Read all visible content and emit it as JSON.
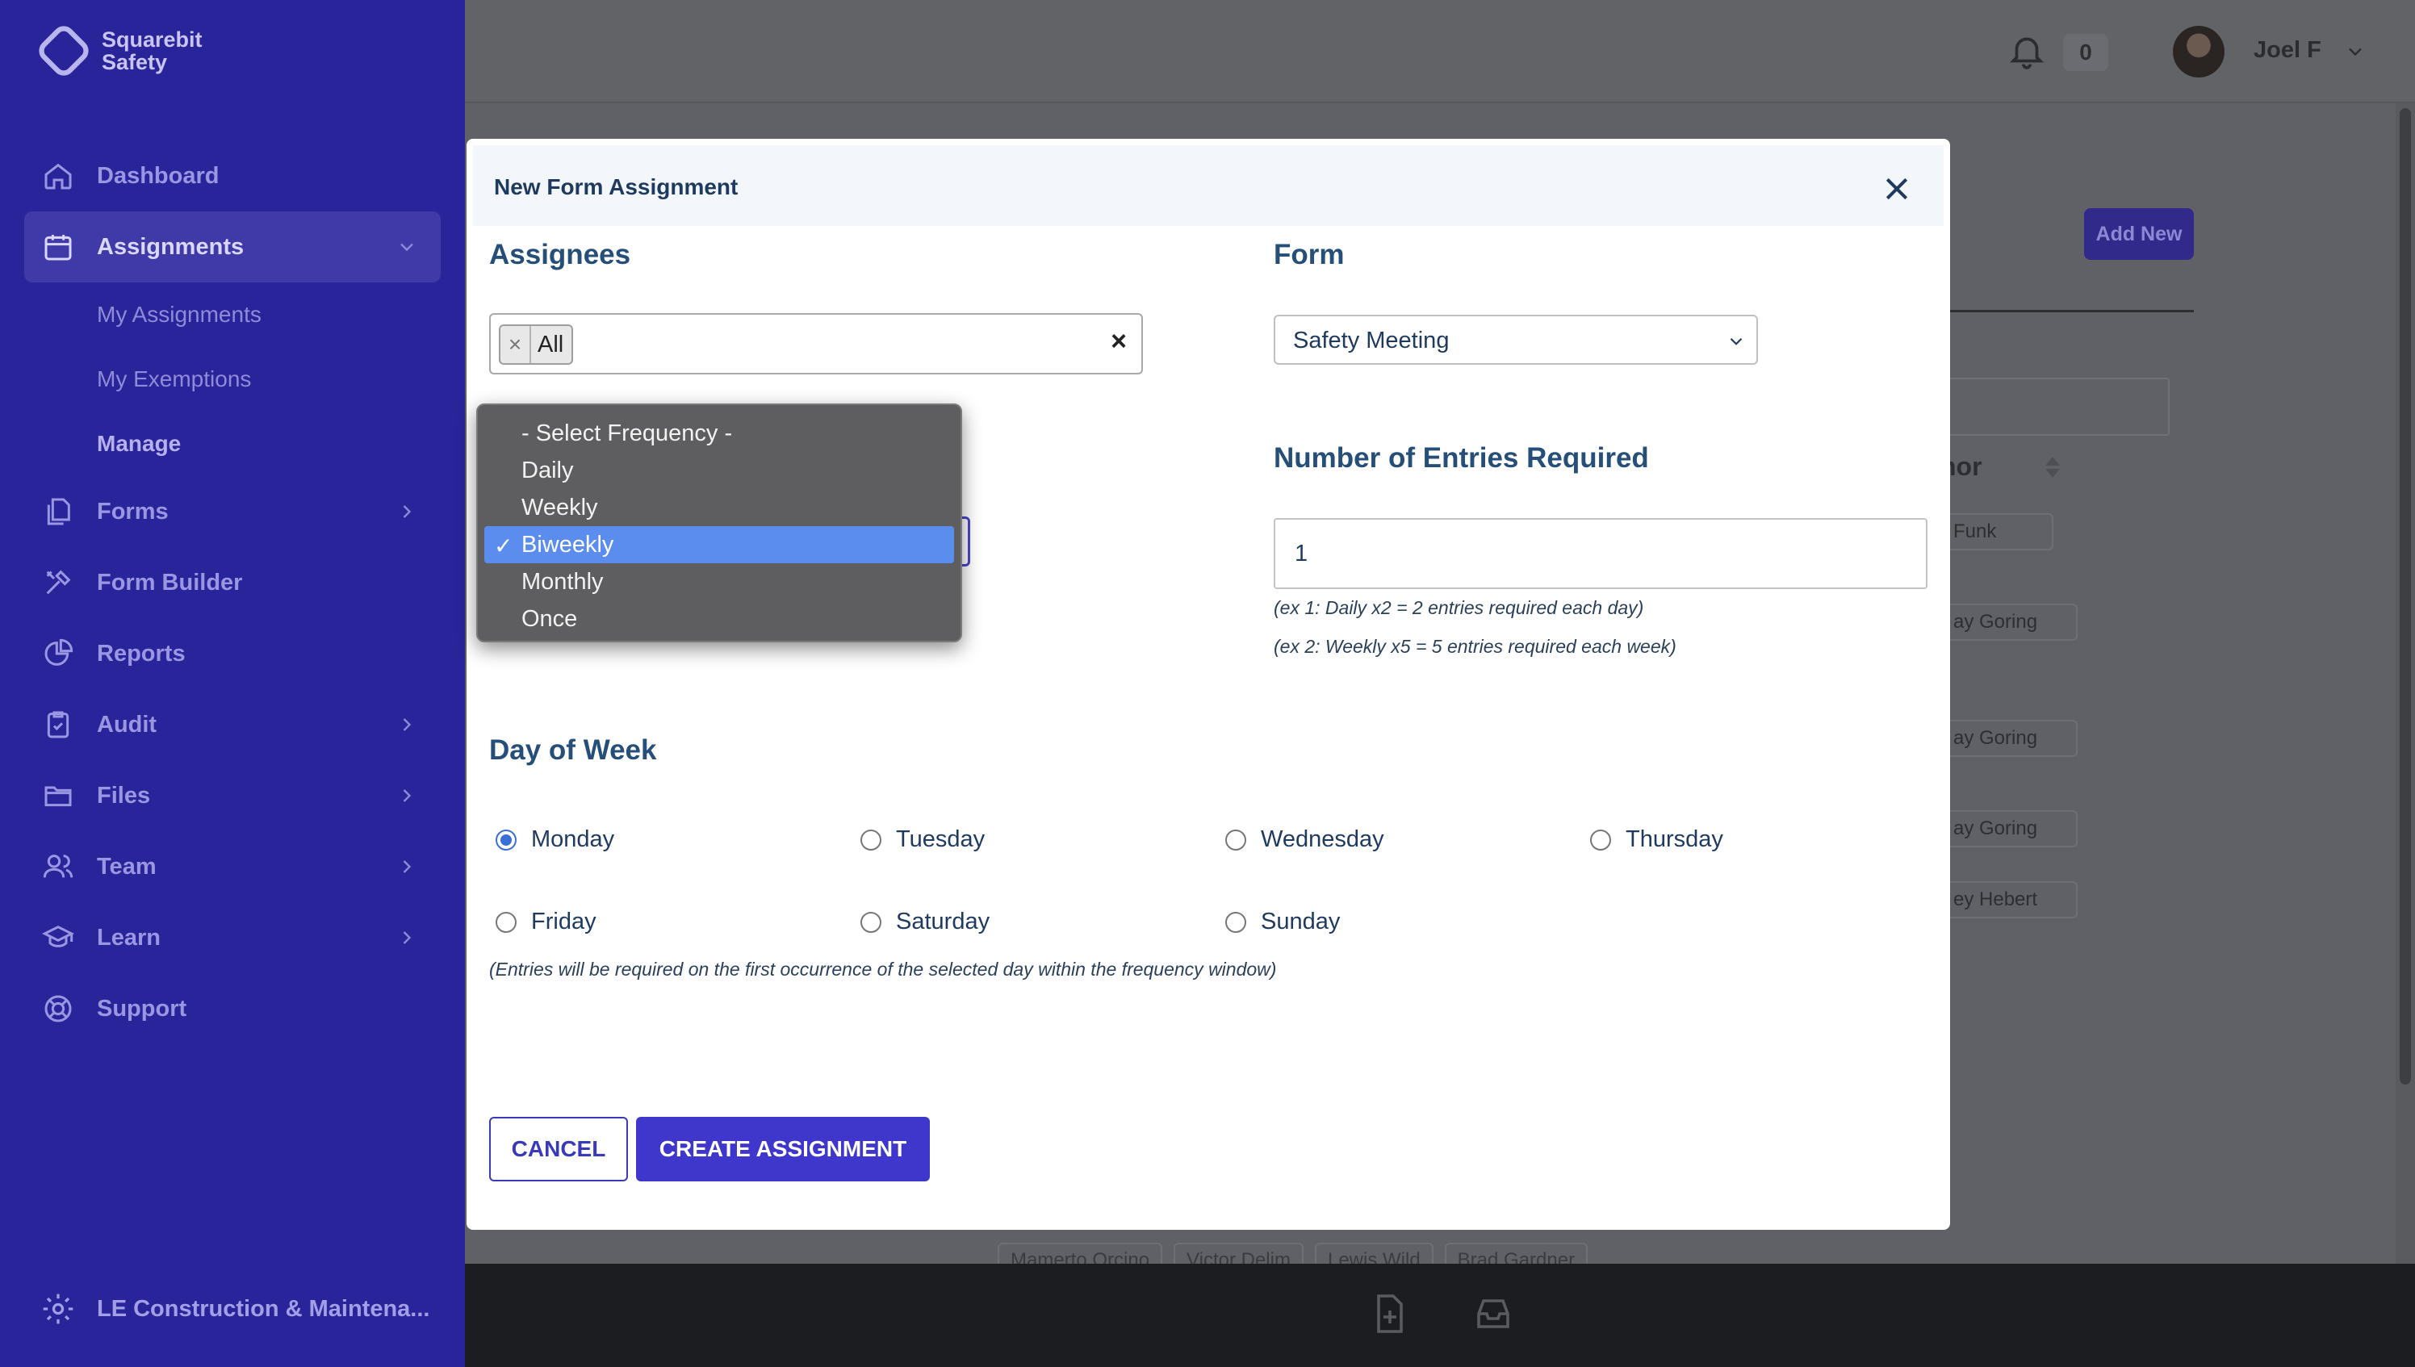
{
  "sidebar": {
    "brand_line1": "Squarebit",
    "brand_line2": "Safety",
    "items": [
      {
        "label": "Dashboard",
        "icon": "home-icon"
      },
      {
        "label": "Assignments",
        "icon": "calendar-icon"
      },
      {
        "label": "Forms",
        "icon": "documents-icon"
      },
      {
        "label": "Form Builder",
        "icon": "tools-icon"
      },
      {
        "label": "Reports",
        "icon": "pie-chart-icon"
      },
      {
        "label": "Audit",
        "icon": "clipboard-check-icon"
      },
      {
        "label": "Files",
        "icon": "folder-icon"
      },
      {
        "label": "Team",
        "icon": "users-icon"
      },
      {
        "label": "Learn",
        "icon": "graduation-cap-icon"
      },
      {
        "label": "Support",
        "icon": "lifebuoy-icon"
      }
    ],
    "sub_items": [
      "My Assignments",
      "My Exemptions",
      "Manage"
    ],
    "org_label": "LE Construction & Maintena..."
  },
  "topbar": {
    "notification_count": "0",
    "user_name": "Joel F"
  },
  "background": {
    "add_new_label": "Add New",
    "column_header": "nor",
    "row_names": [
      "Funk",
      "ay Goring",
      "ay Goring",
      "ay Goring",
      "ey Hebert"
    ],
    "tags": [
      "Mamerto Orcino",
      "Victor Delim",
      "Lewis Wild",
      "Brad Gardner"
    ]
  },
  "modal": {
    "title": "New Form Assignment",
    "assignees": {
      "heading": "Assignees",
      "selected_tags": [
        "All"
      ],
      "clear_symbol": "×",
      "remove_symbol": "×"
    },
    "form": {
      "heading": "Form",
      "selected": "Safety Meeting"
    },
    "frequency": {
      "options": [
        "- Select Frequency -",
        "Daily",
        "Weekly",
        "Biweekly",
        "Monthly",
        "Once"
      ],
      "selected": "Biweekly",
      "selected_index": 3,
      "check_mark": "✓"
    },
    "entries": {
      "heading": "Number of Entries Required",
      "value": "1",
      "hint1": "(ex 1: Daily x2 = 2 entries required each day)",
      "hint2": "(ex 2: Weekly x5 = 5 entries required each week)"
    },
    "day_of_week": {
      "heading": "Day of Week",
      "days": [
        "Monday",
        "Tuesday",
        "Wednesday",
        "Thursday",
        "Friday",
        "Saturday",
        "Sunday"
      ],
      "selected": "Monday",
      "note": "(Entries will be required on the first occurrence of the selected day within the frequency window)"
    },
    "buttons": {
      "cancel": "CANCEL",
      "create": "CREATE ASSIGNMENT"
    }
  },
  "colors": {
    "sidebar_bg": "#2a249a",
    "primary": "#3f37cc",
    "heading": "#254e78",
    "dropdown_selected": "#5b8def"
  }
}
